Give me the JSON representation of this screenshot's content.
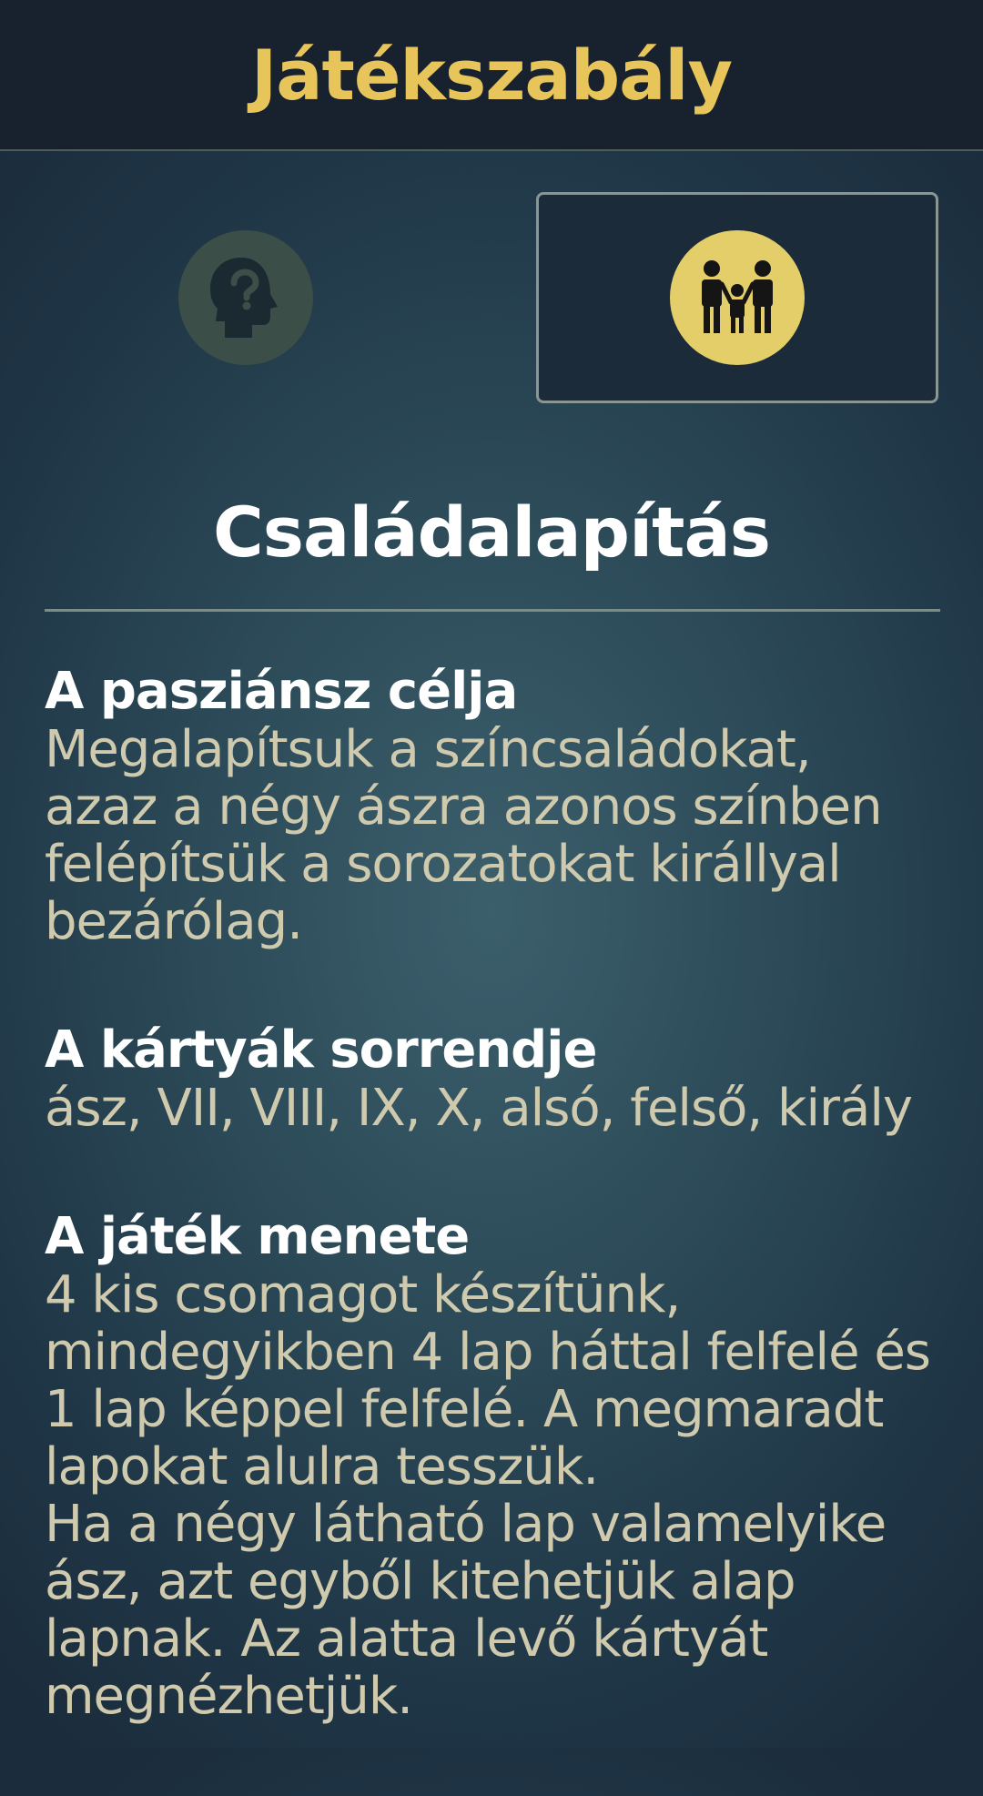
{
  "header": {
    "title": "Játékszabály"
  },
  "tabs": [
    {
      "icon": "head-question-icon",
      "selected": false
    },
    {
      "icon": "family-icon",
      "selected": true
    }
  ],
  "colors": {
    "accent": "#e8c55a",
    "header_bg": "#18222f",
    "body_text": "#cfcaae",
    "heading_text": "#ffffff"
  },
  "section": {
    "title": "Családalapítás"
  },
  "blocks": [
    {
      "heading": "A pasziánsz célja",
      "lines": [
        "Megalapítsuk a színcsaládokat,",
        "azaz a négy ászra azonos színben",
        "felépítsük a sorozatokat királlyal",
        "bezárólag."
      ]
    },
    {
      "heading": "A kártyák sorrendje",
      "lines": [
        "ász, VII, VIII, IX, X, alsó, felső, király"
      ]
    },
    {
      "heading": "A játék menete",
      "lines": [
        "4 kis csomagot készítünk,",
        "mindegyikben 4 lap háttal felfelé és",
        "1 lap képpel felfelé. A megmaradt",
        "lapokat alulra tesszük.",
        "Ha a négy látható lap valamelyike",
        "ász, azt egyből kitehetjük alap",
        "lapnak. Az alatta levő kártyát",
        "megnézhetjük."
      ]
    }
  ]
}
